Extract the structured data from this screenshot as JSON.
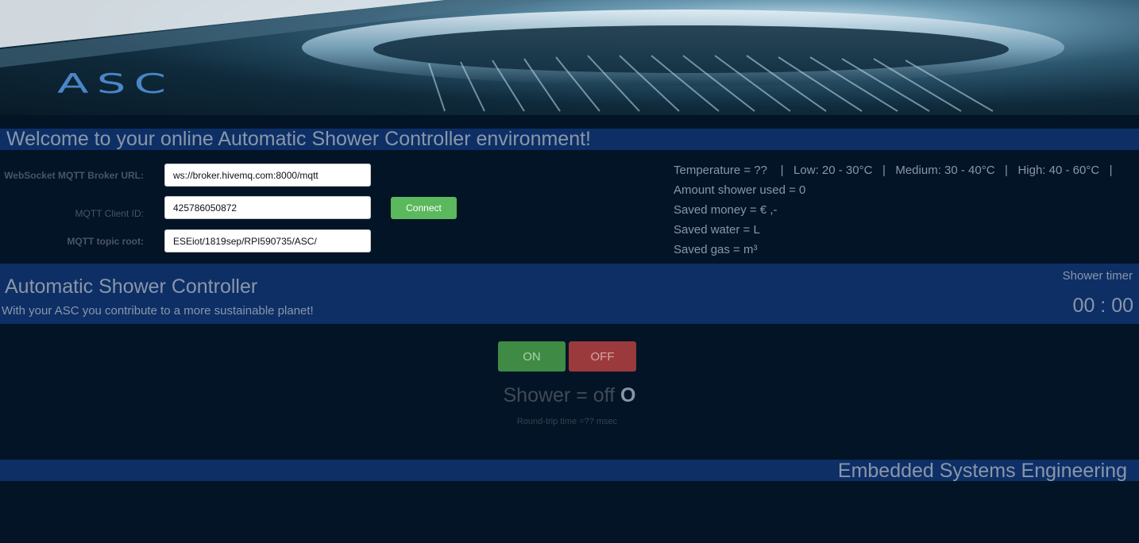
{
  "banner": {
    "logo": "ASC"
  },
  "welcome": {
    "title": "Welcome to your online Automatic Shower Controller environment!"
  },
  "form": {
    "broker_url_label": "WebSocket MQTT Broker URL:",
    "broker_url_value": "ws://broker.hivemq.com:8000/mqtt",
    "client_id_label": "MQTT Client ID:",
    "client_id_value": "425786050872",
    "topic_root_label": "MQTT topic root:",
    "topic_root_value": "ESEiot/1819sep/RPI590735/ASC/",
    "connect_label": "Connect"
  },
  "stats": {
    "temperature": "Temperature = ??    |   Low: 20 - 30°C   |   Medium: 30 - 40°C   |   High: 40 - 60°C   |",
    "amount_shower_used": "Amount shower used = 0",
    "saved_money": "Saved money = € ,-",
    "saved_water": "Saved water = L",
    "saved_gas": "Saved gas = m³"
  },
  "controller": {
    "title": "Automatic Shower Controller",
    "subtitle": "With your ASC you contribute to a more sustainable planet!",
    "timer_label": "Shower timer",
    "timer_value": "00 : 00"
  },
  "controls": {
    "on_label": "ON",
    "off_label": "OFF",
    "status_text": "Shower = off ",
    "status_symbol": "O",
    "round_trip": "Round-trip time =?? msec"
  },
  "footer": {
    "text": "Embedded Systems Engineering"
  },
  "colors": {
    "background": "#021426",
    "bar": "#0d2f66",
    "connect": "#5cb85c",
    "on": "#3f8a44",
    "off": "#9b3a3c",
    "text": "#8a96a8"
  }
}
